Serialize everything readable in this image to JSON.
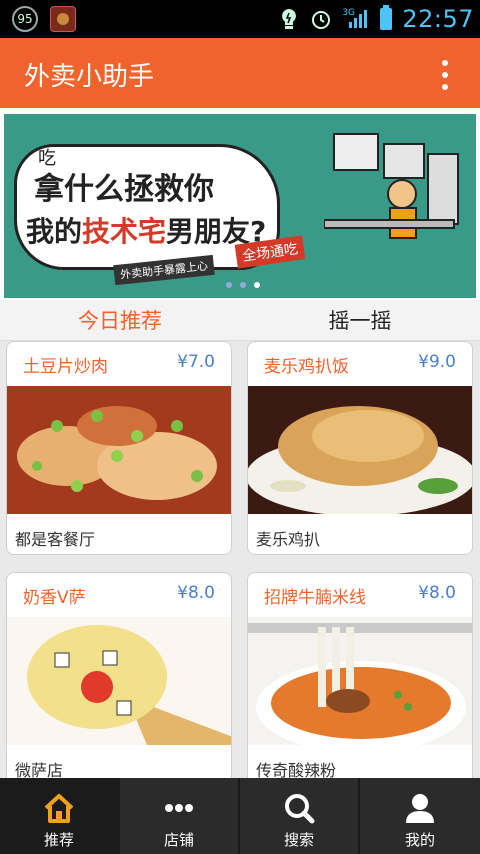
{
  "status_bar": {
    "badge_count": "95",
    "time": "22:57",
    "network": "3G"
  },
  "app_bar": {
    "title": "外卖小助手"
  },
  "banner": {
    "bubble_small": "吃",
    "line1": "拿什么拯救你",
    "line2_pre": "我的",
    "line2_red": "技术宅",
    "line2_post": "男朋友?",
    "stamp": "全场通吃",
    "strip": "外卖助手暴露上心",
    "page_dots": 3,
    "active_dot": 2
  },
  "tabs": [
    {
      "label": "今日推荐",
      "active": true
    },
    {
      "label": "摇一摇",
      "active": false
    }
  ],
  "dishes": [
    {
      "name": "土豆片炒肉",
      "price": "¥7.0",
      "shop": "都是客餐厅"
    },
    {
      "name": "麦乐鸡扒饭",
      "price": "¥9.0",
      "shop": "麦乐鸡扒"
    },
    {
      "name": "奶香V萨",
      "price": "¥8.0",
      "shop": "微萨店"
    },
    {
      "name": "招牌牛腩米线",
      "price": "¥8.0",
      "shop": "传奇酸辣粉"
    }
  ],
  "bottom_nav": [
    {
      "label": "推荐",
      "icon": "home-icon",
      "selected": true
    },
    {
      "label": "店铺",
      "icon": "dots-icon",
      "selected": false
    },
    {
      "label": "搜索",
      "icon": "search-icon",
      "selected": false
    },
    {
      "label": "我的",
      "icon": "person-icon",
      "selected": false
    }
  ],
  "colors": {
    "accent": "#f0632c",
    "price": "#4a7fc8",
    "bottom_nav": "#2b2b2b"
  }
}
